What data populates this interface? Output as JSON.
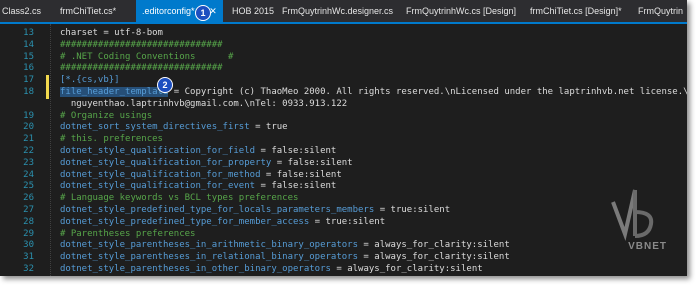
{
  "tabs": [
    {
      "label": "Class2.cs"
    },
    {
      "label": "frmChiTiet.cs*"
    },
    {
      "label": ".editorconfig*"
    },
    {
      "label": "HOB 2015"
    },
    {
      "label": "FrmQuytrinhWc.designer.cs"
    },
    {
      "label": "FrmQuytrinhWc.cs [Design]"
    },
    {
      "label": "frmChiTiet.cs [Design]*"
    },
    {
      "label": "FrmQuytrin"
    }
  ],
  "tab_icons": {
    "pin": "⊕",
    "close": "✕"
  },
  "callouts": {
    "one": "1",
    "two": "2"
  },
  "lines": [
    {
      "n": "13",
      "segs": [
        {
          "t": "charset = utf-8-bom",
          "c": "c-val"
        }
      ]
    },
    {
      "n": "14",
      "segs": [
        {
          "t": "##############################",
          "c": "c-section"
        }
      ]
    },
    {
      "n": "15",
      "segs": [
        {
          "t": "# .NET Coding Conventions      #",
          "c": "c-section"
        }
      ]
    },
    {
      "n": "16",
      "segs": [
        {
          "t": "##############################",
          "c": "c-section"
        }
      ]
    },
    {
      "n": "17",
      "segs": [
        {
          "t": "[*.{cs,vb}]",
          "c": "c-key"
        }
      ]
    },
    {
      "n": "18",
      "segs": [
        {
          "t": "file_header_template",
          "c": "c-key c-sel"
        },
        {
          "t": " = Copyright (c) ThaoMeo 2000. All rights reserved.\\nLicensed under the laptrinhvb.net license.\\nEmail:",
          "c": "c-val"
        }
      ]
    },
    {
      "n": "",
      "segs": [
        {
          "t": "  nguyenthao.laptrinhvb@gmail.com.\\nTel: 0933.913.122",
          "c": "c-val"
        }
      ]
    },
    {
      "n": "19",
      "segs": [
        {
          "t": "# Organize usings",
          "c": "c-comment"
        }
      ]
    },
    {
      "n": "20",
      "segs": [
        {
          "t": "dotnet_sort_system_directives_first",
          "c": "c-key"
        },
        {
          "t": " = true",
          "c": "c-val"
        }
      ]
    },
    {
      "n": "21",
      "segs": [
        {
          "t": "# this. preferences",
          "c": "c-comment"
        }
      ]
    },
    {
      "n": "22",
      "segs": [
        {
          "t": "dotnet_style_qualification_for_field",
          "c": "c-key"
        },
        {
          "t": " = false:silent",
          "c": "c-val"
        }
      ]
    },
    {
      "n": "23",
      "segs": [
        {
          "t": "dotnet_style_qualification_for_property",
          "c": "c-key"
        },
        {
          "t": " = false:silent",
          "c": "c-val"
        }
      ]
    },
    {
      "n": "24",
      "segs": [
        {
          "t": "dotnet_style_qualification_for_method",
          "c": "c-key"
        },
        {
          "t": " = false:silent",
          "c": "c-val"
        }
      ]
    },
    {
      "n": "25",
      "segs": [
        {
          "t": "dotnet_style_qualification_for_event",
          "c": "c-key"
        },
        {
          "t": " = false:silent",
          "c": "c-val"
        }
      ]
    },
    {
      "n": "26",
      "segs": [
        {
          "t": "# Language keywords vs BCL types preferences",
          "c": "c-comment"
        }
      ]
    },
    {
      "n": "27",
      "segs": [
        {
          "t": "dotnet_style_predefined_type_for_locals_parameters_members",
          "c": "c-key"
        },
        {
          "t": " = true:silent",
          "c": "c-val"
        }
      ]
    },
    {
      "n": "28",
      "segs": [
        {
          "t": "dotnet_style_predefined_type_for_member_access",
          "c": "c-key"
        },
        {
          "t": " = true:silent",
          "c": "c-val"
        }
      ]
    },
    {
      "n": "29",
      "segs": [
        {
          "t": "# Parentheses preferences",
          "c": "c-comment"
        }
      ]
    },
    {
      "n": "30",
      "segs": [
        {
          "t": "dotnet_style_parentheses_in_arithmetic_binary_operators",
          "c": "c-key"
        },
        {
          "t": " = always_for_clarity:silent",
          "c": "c-val"
        }
      ]
    },
    {
      "n": "31",
      "segs": [
        {
          "t": "dotnet_style_parentheses_in_relational_binary_operators",
          "c": "c-key"
        },
        {
          "t": " = always_for_clarity:silent",
          "c": "c-val"
        }
      ]
    },
    {
      "n": "32",
      "segs": [
        {
          "t": "dotnet_style_parentheses_in_other_binary_operators",
          "c": "c-key"
        },
        {
          "t": " = always_for_clarity:silent",
          "c": "c-val"
        }
      ]
    }
  ],
  "watermark": {
    "text": "VBNET"
  },
  "colors": {
    "accent": "#007acc",
    "keyword": "#569cd6",
    "comment": "#57a64a",
    "line_number": "#2b91af",
    "callout": "#1d4fc0"
  }
}
